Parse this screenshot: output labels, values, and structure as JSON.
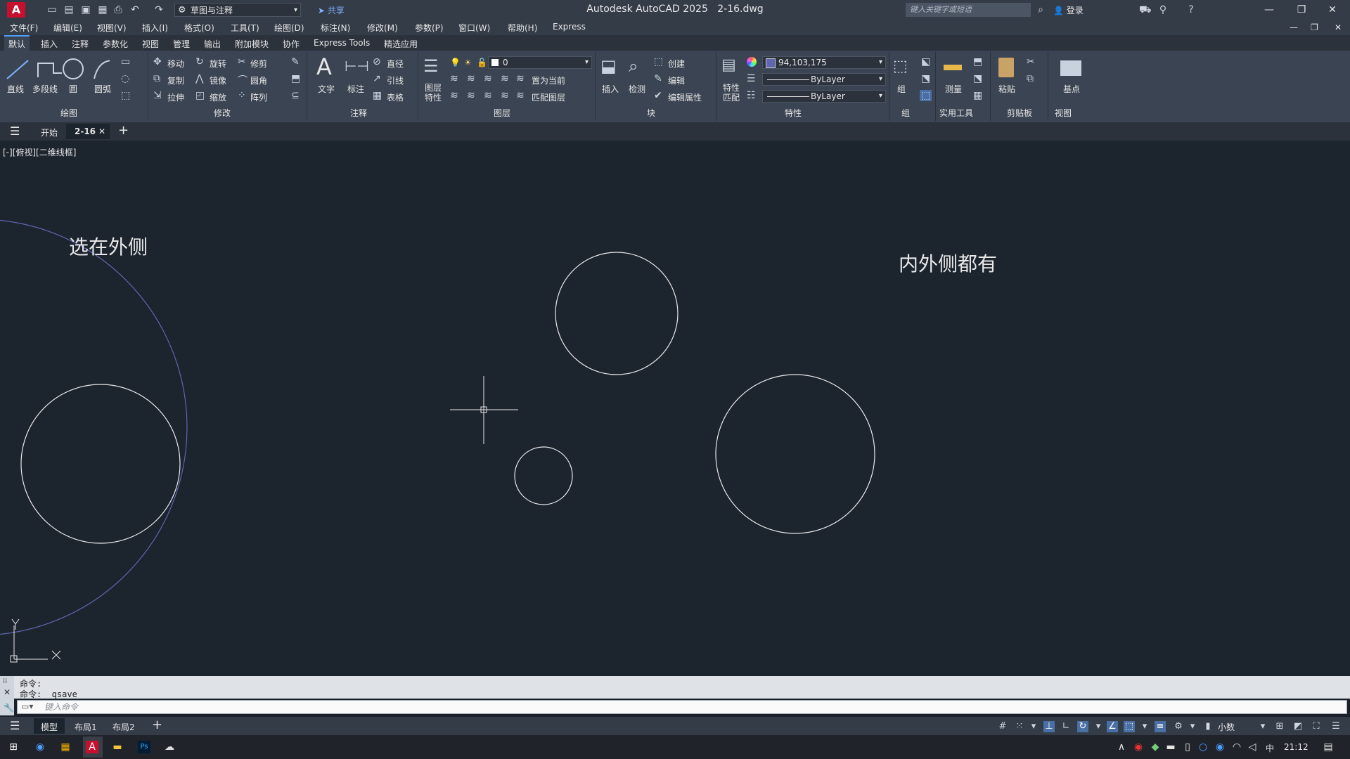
{
  "titlebar": {
    "app_title": "Autodesk AutoCAD 2025",
    "file_title": "2-16.dwg",
    "workspace": "草图与注释",
    "share": "共享",
    "search_placeholder": "键入关键字或短语",
    "login": "登录"
  },
  "menu": [
    "文件(F)",
    "编辑(E)",
    "视图(V)",
    "插入(I)",
    "格式(O)",
    "工具(T)",
    "绘图(D)",
    "标注(N)",
    "修改(M)",
    "参数(P)",
    "窗口(W)",
    "帮助(H)",
    "Express"
  ],
  "ribbon_tabs": [
    "默认",
    "插入",
    "注释",
    "参数化",
    "视图",
    "管理",
    "输出",
    "附加模块",
    "协作",
    "Express Tools",
    "精选应用"
  ],
  "ribbon": {
    "draw": {
      "line": "直线",
      "polyline": "多段线",
      "circle": "圆",
      "arc": "圆弧",
      "panel": "绘图"
    },
    "modify": {
      "move": "移动",
      "rotate": "旋转",
      "trim": "修剪",
      "copy": "复制",
      "mirror": "镜像",
      "fillet": "圆角",
      "stretch": "拉伸",
      "scale": "缩放",
      "array": "阵列",
      "panel": "修改"
    },
    "annotation": {
      "text": "文字",
      "dimension": "标注",
      "diameter": "直径",
      "leader": "引线",
      "table": "表格",
      "panel": "注释"
    },
    "layers": {
      "properties": "图层\n特性",
      "current_layer": "0",
      "set_current": "置为当前",
      "match_layer": "匹配图层",
      "panel": "图层"
    },
    "block": {
      "insert": "插入",
      "detect": "检测",
      "create": "创建",
      "edit": "编辑",
      "edit_attr": "编辑属性",
      "panel": "块"
    },
    "properties": {
      "match": "特性\n匹配",
      "color": "94,103,175",
      "linetype": "ByLayer",
      "lineweight": "ByLayer",
      "panel": "特性"
    },
    "group": {
      "panel": "组",
      "label": "组"
    },
    "utilities": {
      "measure": "测量",
      "panel": "实用工具"
    },
    "clipboard": {
      "paste": "粘贴",
      "panel": "剪贴板"
    },
    "view": {
      "base": "基点",
      "panel": "视图"
    }
  },
  "file_tabs": {
    "start": "开始",
    "current": "2-16"
  },
  "viewport": {
    "view_controls": "[-][俯视][二维线框]",
    "text1": "选在外侧",
    "text2": "内外侧都有"
  },
  "command": {
    "history1": "命令:",
    "history2": "命令: _qsave",
    "placeholder": "键入命令"
  },
  "layout_tabs": [
    "模型",
    "布局1",
    "布局2"
  ],
  "status": {
    "units": "小数"
  },
  "taskbar": {
    "time": "21:12",
    "ime": "中"
  },
  "colors": {
    "selected_circle": "#5e67af",
    "accent": "#4d9fff"
  }
}
